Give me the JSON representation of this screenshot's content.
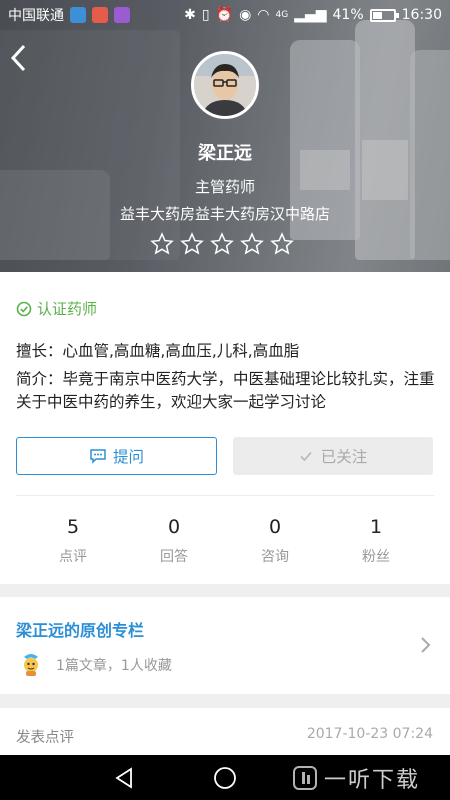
{
  "status_bar": {
    "carrier": "中国联通",
    "signal": "4G",
    "battery": "41%",
    "time": "16:30"
  },
  "profile": {
    "name": "梁正远",
    "title": "主管药师",
    "store": "益丰大药房益丰大药房汉中路店",
    "rating_stars": 0,
    "rating_max": 5
  },
  "info": {
    "verified": "认证药师",
    "specialty": "擅长：心血管,高血糖,高血压,儿科,高血脂",
    "intro": "简介：毕竟于南京中医药大学，中医基础理论比较扎实，注重关于中医中药的养生，欢迎大家一起学习讨论"
  },
  "buttons": {
    "ask": "提问",
    "follow": "已关注"
  },
  "stats": [
    {
      "value": "5",
      "label": "点评"
    },
    {
      "value": "0",
      "label": "回答"
    },
    {
      "value": "0",
      "label": "咨询"
    },
    {
      "value": "1",
      "label": "粉丝"
    }
  ],
  "column": {
    "title": "梁正远的原创专栏",
    "meta": "1篇文章，1人收藏"
  },
  "comment": {
    "title": "发表点评",
    "date": "2017-10-23 07:24"
  },
  "watermark": "一听下载",
  "colors": {
    "accent_blue": "#2c8fd6",
    "verified_green": "#59b14a",
    "follow_bg": "#ececec"
  }
}
